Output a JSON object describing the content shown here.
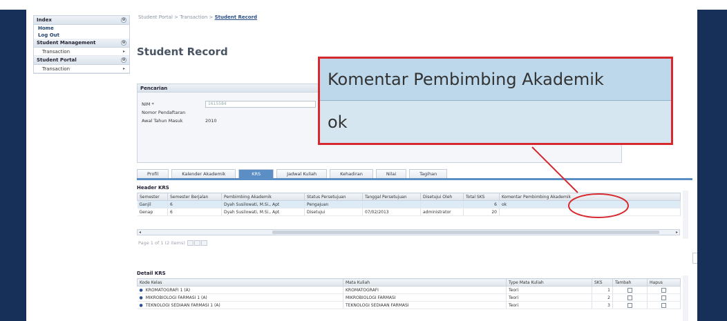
{
  "sidebar": {
    "sections": [
      {
        "title": "Index",
        "toggle": "⊕"
      },
      {
        "title": "Student Management",
        "toggle": "⊕"
      },
      {
        "title": "Student Portal",
        "toggle": "⊕"
      }
    ],
    "links": [
      "Home",
      "Log Out"
    ],
    "items": [
      {
        "label": "Transaction",
        "arrow": "▸"
      },
      {
        "label": "Transaction",
        "arrow": "▸"
      }
    ]
  },
  "breadcrumb": {
    "part1": "Student Portal",
    "sep": " > ",
    "part2": "Transaction",
    "current": "Student Record"
  },
  "page_title": "Student Record",
  "search_panel": {
    "title": "Pencarian",
    "fields": [
      {
        "label": "NIM *",
        "value": "1615584"
      },
      {
        "label": "Nomor Pendaftaran",
        "value": ""
      },
      {
        "label": "Awal Tahun Masuk",
        "value": "2010"
      }
    ]
  },
  "tabs": [
    {
      "label": "Profil",
      "active": false
    },
    {
      "label": "Kalender Akademik",
      "active": false
    },
    {
      "label": "KRS",
      "active": true
    },
    {
      "label": "Jadwal Kuliah",
      "active": false
    },
    {
      "label": "Kehadiran",
      "active": false
    },
    {
      "label": "Nilai",
      "active": false
    },
    {
      "label": "Tagihan",
      "active": false
    }
  ],
  "header_krs": {
    "title": "Header KRS",
    "columns": [
      "Semester",
      "Semester Berjalan",
      "Pembimbing Akademik",
      "Status Persetujuan",
      "Tanggal Persetujuan",
      "Disetujui Oleh",
      "Total SKS",
      "Komentar Pembimbing Akademik"
    ],
    "rows": [
      [
        "Ganjil",
        "6",
        "Dyah Susilowati, M.Si., Apt",
        "Pengajuan",
        "",
        "",
        "6",
        "ok"
      ],
      [
        "Genap",
        "6",
        "Dyah Susilowati, M.Si., Apt",
        "Disetujui",
        "07/02/2013",
        "administrator",
        "20",
        ""
      ]
    ],
    "scroll_left": "◂",
    "scroll_right": "▸",
    "pager": "Page 1 of 1 (2 items)"
  },
  "detail_krs": {
    "title": "Detail KRS",
    "columns": [
      "Kode Kelas",
      "Mata Kuliah",
      "Type Mata Kuliah",
      "SKS",
      "Tambah",
      "Hapus"
    ],
    "rows": [
      [
        "KROMATOGRAFI 1 (A)",
        "KROMATOGRAFI",
        "Teori",
        "1"
      ],
      [
        "MIKROBIOLOGI FARMASI 1 (A)",
        "MIKROBIOLOGI FARMASI",
        "Teori",
        "2"
      ],
      [
        "TEKNOLOGI SEDIAAN FARMASI 1 (A)",
        "TEKNOLOGI SEDIAAN FARMASI",
        "Teori",
        "3"
      ]
    ]
  },
  "callout": {
    "title": "Komentar Pembimbing Akademik",
    "value": "ok"
  },
  "colors": {
    "frame": "#16305a",
    "accent": "#5b8ec5",
    "annotation": "#d7282e"
  }
}
